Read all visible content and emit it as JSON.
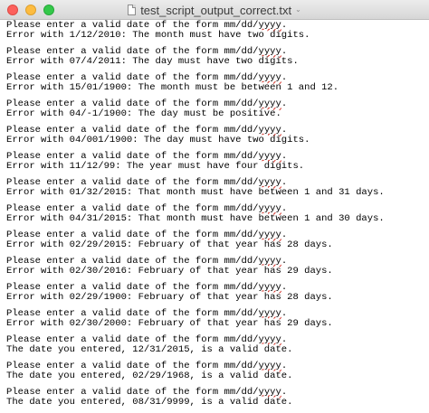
{
  "window": {
    "title": "test_script_output_correct.txt"
  },
  "prompt": {
    "prefix": "Please enter a valid date of the form mm/dd/",
    "spell_word": "yyyy",
    "suffix": "."
  },
  "blocks": [
    {
      "result": "Error with 1/12/2010: The month must have two digits."
    },
    {
      "result": "Error with 07/4/2011: The day must have two digits."
    },
    {
      "result": "Error with 15/01/1900: The month must be between 1 and 12."
    },
    {
      "result": "Error with 04/-1/1900: The day must be positive."
    },
    {
      "result": "Error with 04/001/1900: The day must have two digits."
    },
    {
      "result": "Error with 11/12/99: The year must have four digits."
    },
    {
      "result": "Error with 01/32/2015: That month must have between 1 and 31 days."
    },
    {
      "result": "Error with 04/31/2015: That month must have between 1 and 30 days."
    },
    {
      "result": "Error with 02/29/2015: February of that year has 28 days."
    },
    {
      "result": "Error with 02/30/2016: February of that year has 29 days."
    },
    {
      "result": "Error with 02/29/1900: February of that year has 28 days."
    },
    {
      "result": "Error with 02/30/2000: February of that year has 29 days."
    },
    {
      "result": "The date you entered, 12/31/2015, is a valid date."
    },
    {
      "result": "The date you entered, 02/29/1968, is a valid date."
    },
    {
      "result": "The date you entered, 08/31/9999, is a valid date."
    }
  ]
}
